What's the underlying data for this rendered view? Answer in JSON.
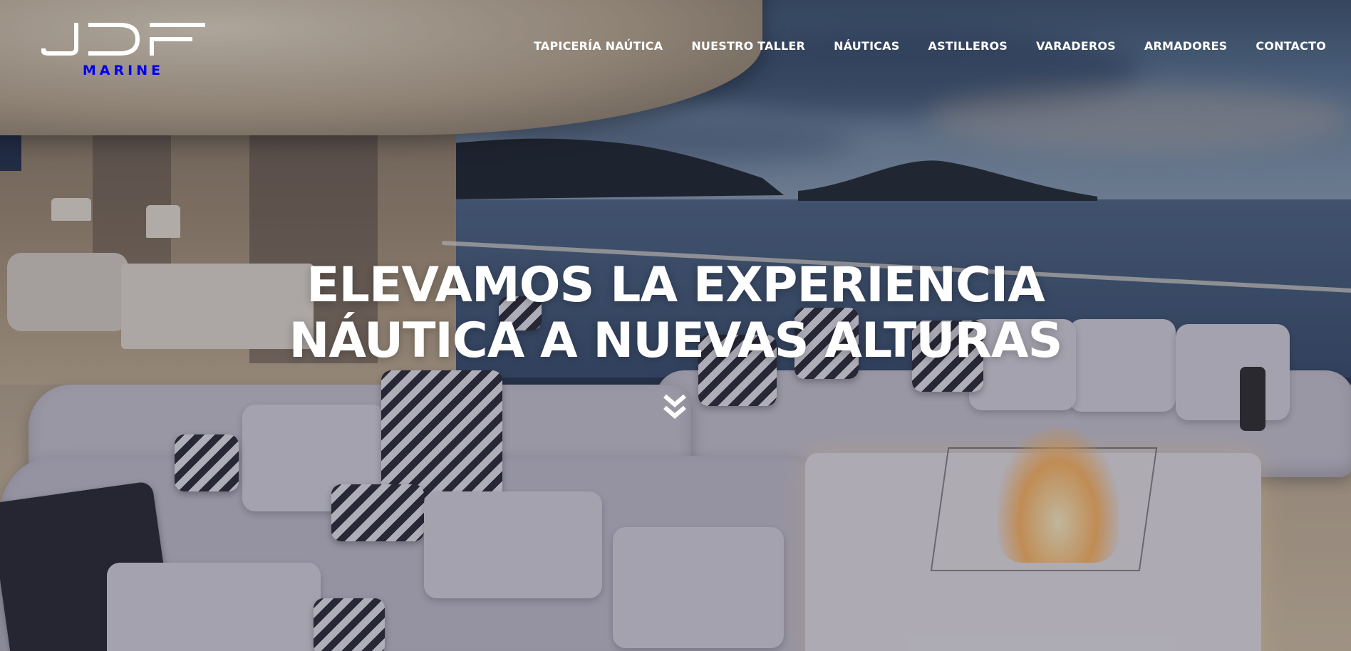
{
  "brand": {
    "name": "JDF",
    "subtitle": "MARINE"
  },
  "nav": {
    "items": [
      {
        "label": "TAPICERÍA NAÚTICA"
      },
      {
        "label": "NUESTRO TALLER"
      },
      {
        "label": "NÁUTICAS"
      },
      {
        "label": "ASTILLEROS"
      },
      {
        "label": "VARADEROS"
      },
      {
        "label": "ARMADORES"
      },
      {
        "label": "CONTACTO"
      }
    ]
  },
  "hero": {
    "title_line1": "ELEVAMOS LA EXPERIENCIA",
    "title_line2": "NÁUTICA A NUEVAS ALTURAS",
    "scroll_icon": "double-chevron-down-icon",
    "background_image": "yacht-deck-lounge-at-dusk"
  },
  "colors": {
    "text": "#ffffff",
    "overlay": "#1c1e30"
  }
}
